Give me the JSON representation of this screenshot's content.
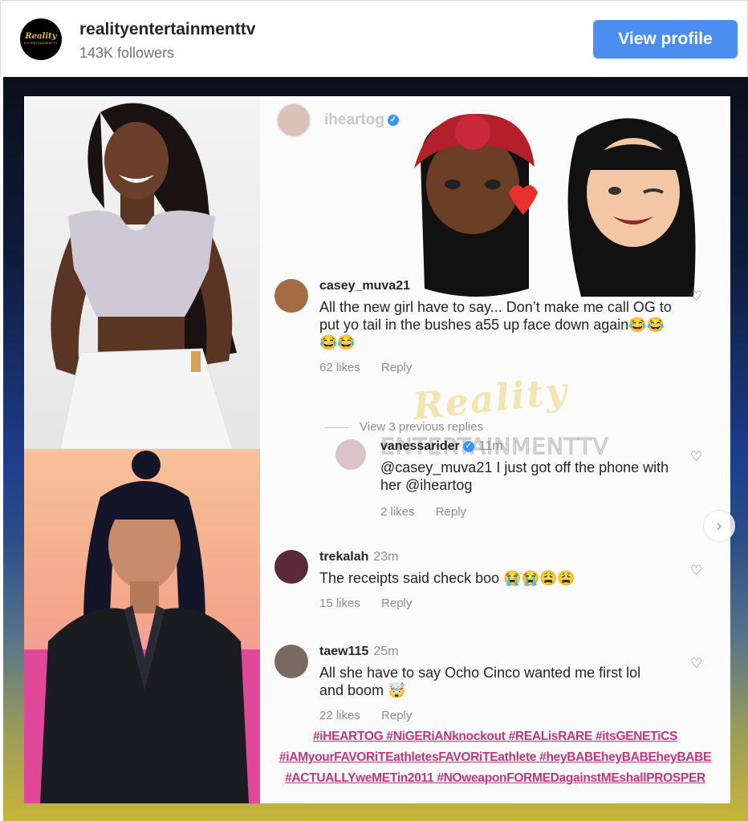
{
  "header": {
    "avatar_line1": "Reality",
    "avatar_line2": "ENTERTAINMENTTV",
    "username": "realityentertainmenttv",
    "followers": "143K followers",
    "view_profile_label": "View profile"
  },
  "post": {
    "embedded_user": "iheartog",
    "comments": [
      {
        "user": "casey_muva21",
        "time": "",
        "text": "All the new girl have to say... Don’t make me call OG to put yo tail in the bushes a55 up face down again😂😂😂😂",
        "likes": "62 likes",
        "reply": "Reply"
      },
      {
        "user": "vanessarider",
        "time": "11m",
        "text": "@casey_muva21 I just got off the phone with her @iheartog",
        "likes": "2 likes",
        "reply": "Reply"
      },
      {
        "user": "trekalah",
        "time": "23m",
        "text": "The receipts said check boo 😭😭😩😩",
        "likes": "15 likes",
        "reply": "Reply"
      },
      {
        "user": "taew115",
        "time": "25m",
        "text": "All she have to say Ocho Cinco wanted me first lol and boom 🤯",
        "likes": "22 likes",
        "reply": "Reply"
      }
    ],
    "view_replies": "View 3 previous replies",
    "watermark_line1": "Reality",
    "watermark_line2": "ENTERTAINMENTTV",
    "hashtags": [
      "#iHEARTOG #NiGERiANknockout #REALisRARE #itsGENETiCS",
      "#iAMyourFAVORiTEathletesFAVORiTEathlete #heyBABEheyBABEheyBABE",
      "#ACTUALLYweMETin2011 #NOweaponFORMEDagainstMEshallPROSPER"
    ]
  },
  "colors": {
    "accent": "#4a8ff0",
    "hashtag": "#c23381"
  }
}
